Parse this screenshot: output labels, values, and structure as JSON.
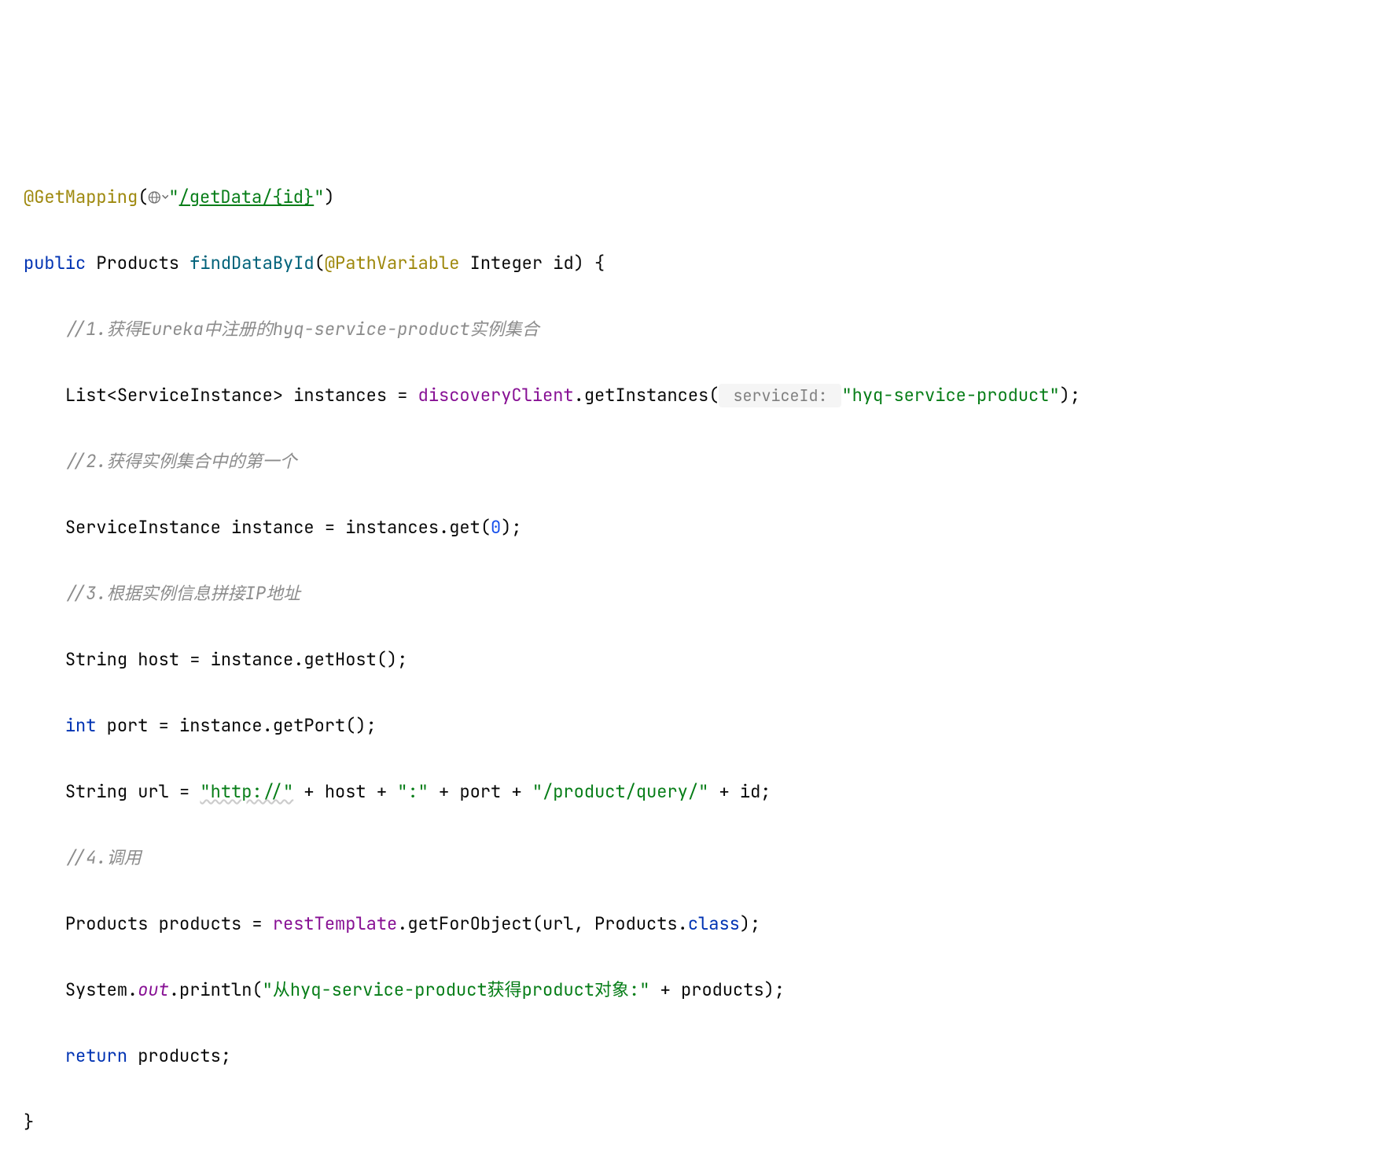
{
  "l1": {
    "ann": "@GetMapping",
    "p1": "(",
    "url": "/getData/{id}",
    "p2": ")",
    "q": "\""
  },
  "l2": {
    "kw": "public",
    "type": "Products",
    "m": "findDataById",
    "p1": "(",
    "ann": "@PathVariable",
    "argtype": "Integer",
    "argname": "id",
    "p2": ") {"
  },
  "l3": {
    "c": "//1.获得Eureka中注册的hyq-service-product实例集合"
  },
  "l4": {
    "a": "List<ServiceInstance> instances = ",
    "field": "discoveryClient",
    "b": ".getInstances(",
    "hint": " serviceId: ",
    "str": "\"hyq-service-product\"",
    "c": ");"
  },
  "l5": {
    "c": "//2.获得实例集合中的第一个"
  },
  "l6": {
    "a": "ServiceInstance instance = instances.get(",
    "n": "0",
    "b": ");"
  },
  "l7": {
    "c": "//3.根据实例信息拼接IP地址"
  },
  "l8": {
    "a": "String host = instance.getHost();"
  },
  "l9": {
    "kw": "int",
    "a": " port = instance.getPort();"
  },
  "l10": {
    "a": "String url = ",
    "s1": "\"http://\"",
    "b": " + host + ",
    "s2": "\":\"",
    "c": " + port + ",
    "s3": "\"/product/query/\"",
    "d": " + id;"
  },
  "l11": {
    "c": "//4.调用"
  },
  "l12": {
    "a": "Products products = ",
    "field": "restTemplate",
    "b": ".getForObject(url, Products.",
    "kw": "class",
    "c": ");"
  },
  "l13": {
    "a": "System.",
    "out": "out",
    "b": ".println(",
    "s": "\"从hyq-service-product获得product对象:\"",
    "c": " + products);"
  },
  "l14": {
    "kw": "return",
    "a": " products;"
  },
  "l15": {
    "a": "}"
  }
}
